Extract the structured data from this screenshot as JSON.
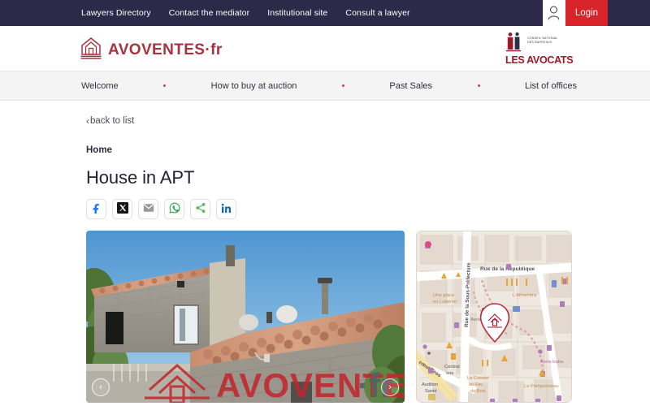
{
  "topbar": {
    "links": [
      {
        "label": "Lawyers Directory"
      },
      {
        "label": "Contact the mediator"
      },
      {
        "label": "Institutional site"
      },
      {
        "label": "Consult a lawyer"
      }
    ],
    "login_label": "Login",
    "user_icon": "user-icon",
    "background": "#2c2a48",
    "login_color": "#d8232a"
  },
  "brand": {
    "name": "AVOVENTES·fr",
    "icon": "house-gavel-logo-icon",
    "color": "#a83240"
  },
  "partner_logo": {
    "line1": "CONSEIL NATIONAL",
    "line2": "DES BARREAUX",
    "wordmark": "LES AVOCATS",
    "icon": "lawyers-figures-icon",
    "color": "#a0162a"
  },
  "mainnav": {
    "items": [
      {
        "label": "Welcome"
      },
      {
        "label": "How to buy at auction"
      },
      {
        "label": "Past Sales"
      },
      {
        "label": "List of offices"
      }
    ],
    "separator_color": "#c8443c",
    "background": "#f4f4f4"
  },
  "page": {
    "back_label": "back to list",
    "back_icon": "chevron-left-icon",
    "breadcrumb": "Home",
    "title": "House in APT"
  },
  "share": {
    "buttons": [
      {
        "name": "facebook-icon",
        "label": "Facebook",
        "color": "#1877f2"
      },
      {
        "name": "x-twitter-icon",
        "label": "X",
        "color": "#000000"
      },
      {
        "name": "email-icon",
        "label": "Email",
        "color": "#9a9a9a"
      },
      {
        "name": "whatsapp-icon",
        "label": "WhatsApp",
        "color": "#25d366"
      },
      {
        "name": "share-icon",
        "label": "Share",
        "color": "#5cb85c"
      },
      {
        "name": "linkedin-icon",
        "label": "LinkedIn",
        "color": "#0a66c2"
      }
    ]
  },
  "photo": {
    "alt": "Stone house with terracotta tile roof under blue sky",
    "watermark": "AVOVENTES·fr",
    "prev_icon": "chevron-left-icon",
    "next_icon": "chevron-right-icon"
  },
  "map": {
    "marker_icon": "property-pin-icon",
    "streets": [
      "Rue de la République",
      "Rue de la Sous-Préfecture",
      "cœur Gros"
    ],
    "places": [
      "Une glace en Luberon",
      "L'Alhambra",
      "Aeris-Informatique",
      "Anna baba",
      "Le Pamponneau",
      "La Cuisine au Feu de Bois",
      "Central sou",
      "Audition Santé"
    ]
  }
}
